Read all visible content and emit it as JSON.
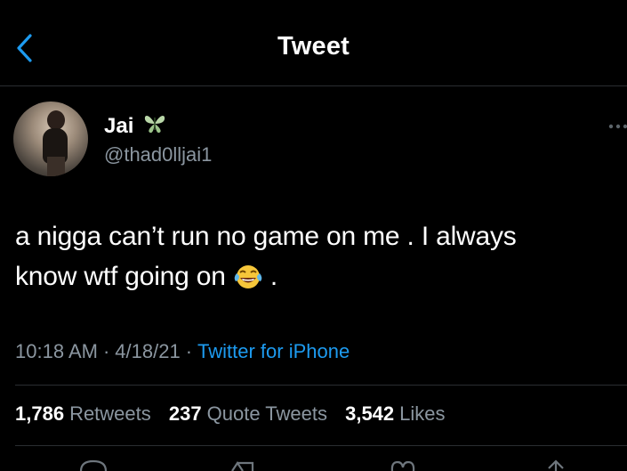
{
  "nav": {
    "title": "Tweet"
  },
  "author": {
    "name": "Jai",
    "handle": "@thad0lljai1"
  },
  "tweet": {
    "text_line1": "a nigga can’t run no game on me . I always",
    "text_line2_before": "know wtf going on",
    "text_line2_after": " .",
    "emoji": "face-with-tears-of-joy"
  },
  "meta": {
    "time": "10:18 AM",
    "sep1": "·",
    "date": "4/18/21",
    "sep2": "·",
    "source": "Twitter for iPhone"
  },
  "stats": {
    "retweets_count": "1,786",
    "retweets_label": "Retweets",
    "quotes_count": "237",
    "quotes_label": "Quote Tweets",
    "likes_count": "3,542",
    "likes_label": "Likes"
  },
  "colors": {
    "background": "#000000",
    "accent": "#1d9bf0",
    "secondary_text": "#8b96a0",
    "divider": "#2a2d31"
  },
  "icons": [
    "back-chevron-icon",
    "butterfly-icon",
    "more-icon",
    "reply-icon",
    "retweet-icon",
    "like-icon",
    "share-icon"
  ]
}
